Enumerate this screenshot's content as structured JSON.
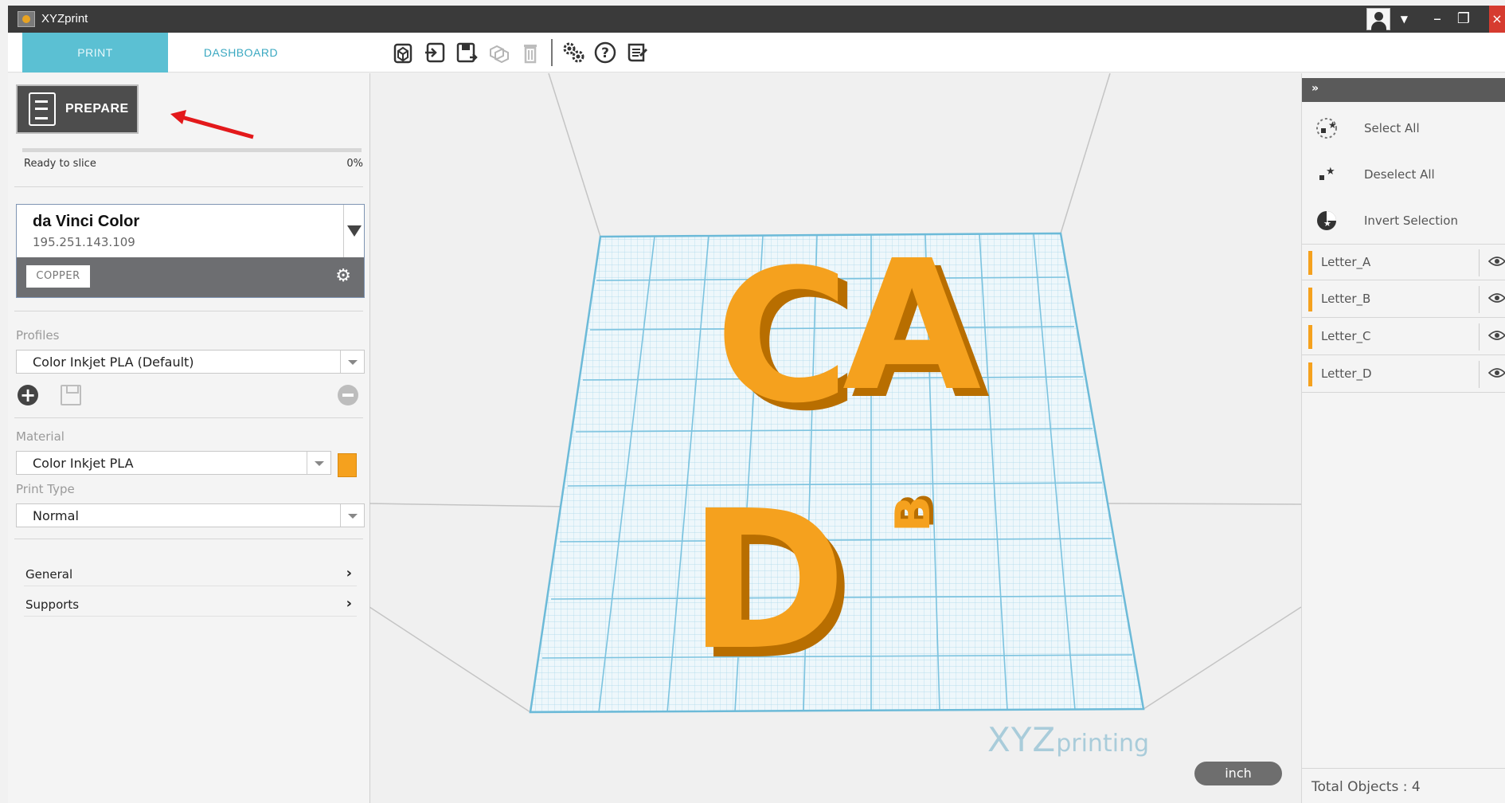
{
  "window": {
    "title": "XYZprint"
  },
  "nav": {
    "tabs": [
      "PRINT",
      "DASHBOARD"
    ]
  },
  "toolbar": {
    "icons": [
      "open-model-icon",
      "import-icon",
      "save-project-icon",
      "duplicate-icon",
      "delete-icon",
      "settings-icon",
      "help-icon",
      "notes-icon"
    ]
  },
  "prepare": {
    "label": "PREPARE",
    "status": "Ready to slice",
    "percent_label": "0%",
    "progress": 0
  },
  "printer": {
    "name": "da Vinci Color",
    "ip": "195.251.143.109",
    "badge": "COPPER"
  },
  "profiles": {
    "label": "Profiles",
    "selected": "Color Inkjet PLA (Default)"
  },
  "material": {
    "label": "Material",
    "selected": "Color Inkjet PLA",
    "color": "#F5A11E"
  },
  "print_type": {
    "label": "Print Type",
    "selected": "Normal"
  },
  "sections": [
    "General",
    "Supports"
  ],
  "viewport": {
    "letters": [
      "C",
      "A",
      "B",
      "D"
    ],
    "brand_big": "XYZ",
    "brand_small": "printing",
    "unit": "inch",
    "grid_color": "#7cc3df",
    "object_color": "#F5A11E"
  },
  "right_panel": {
    "actions": [
      "Select All",
      "Deselect All",
      "Invert Selection"
    ],
    "objects": [
      "Letter_A",
      "Letter_B",
      "Letter_C",
      "Letter_D"
    ],
    "total": "Total Objects : 4"
  },
  "colors": {
    "accent": "#5BC0D3",
    "titlebar": "#3A3A3A",
    "annotation": "#E3191B"
  }
}
